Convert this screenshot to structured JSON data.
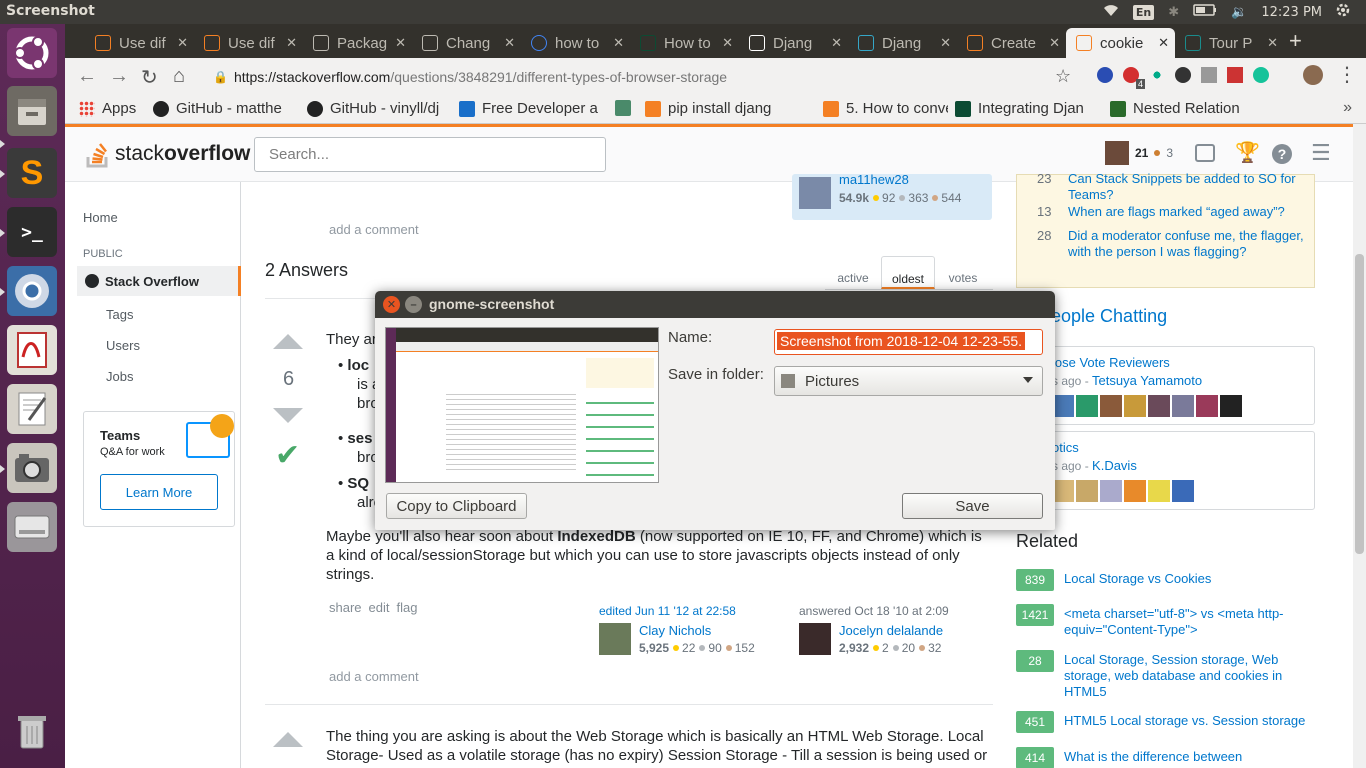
{
  "panel": {
    "app_title": "Screenshot",
    "lang": "En",
    "time": "12:23 PM"
  },
  "browser": {
    "tabs": [
      {
        "label": "Use dif",
        "icon": "so",
        "color": "#f48024"
      },
      {
        "label": "Use dif",
        "icon": "so",
        "color": "#f48024"
      },
      {
        "label": "Packag",
        "icon": "doc",
        "color": "#bdbab2"
      },
      {
        "label": "Chang",
        "icon": "doc",
        "color": "#bdbab2"
      },
      {
        "label": "how to",
        "icon": "G",
        "color": "#4285f4"
      },
      {
        "label": "How to",
        "icon": "dj",
        "color": "#0c4b33"
      },
      {
        "label": "Djang",
        "icon": "gh",
        "color": "#ffffff"
      },
      {
        "label": "Djang",
        "icon": "pk",
        "color": "#35a7c8"
      },
      {
        "label": "Create",
        "icon": "so",
        "color": "#f48024"
      },
      {
        "label": "cookie",
        "icon": "so",
        "color": "#f48024"
      },
      {
        "label": "Tour P",
        "icon": "tp",
        "color": "#1a8c8c"
      }
    ],
    "url_domain": "https://stackoverflow.com",
    "url_path": "/questions/3848291/different-types-of-browser-storage",
    "ext_badge": "4",
    "bookmarks": [
      "Apps",
      "GitHub - matthe",
      "GitHub - vinyll/dj",
      "Free Developer a",
      "",
      "pip install djang",
      "5. How to conver",
      "Integrating Djan",
      "Nested Relation"
    ]
  },
  "so": {
    "logo_a": "stack",
    "logo_b": "overflow",
    "search_placeholder": "Search...",
    "rep": "21",
    "bronze": "3",
    "nav": {
      "home": "Home",
      "public": "PUBLIC",
      "stack_overflow": "Stack Overflow",
      "tags": "Tags",
      "users": "Users",
      "jobs": "Jobs"
    },
    "teams": {
      "title": "Teams",
      "sub": "Q&A for work",
      "btn": "Learn More"
    },
    "question_user": {
      "name": "ma11hew28",
      "rep": "54.9k",
      "gold": "92",
      "silver": "363",
      "bronze": "544"
    },
    "add_comment": "add a comment",
    "answers_count": "2 Answers",
    "sort": [
      "active",
      "oldest",
      "votes"
    ],
    "answer1": {
      "votes": "6",
      "p_intro": "They ar",
      "b1": "loc",
      "b1_cont": "is a",
      "b1_cont2": "bro",
      "b2": "ses",
      "b2_cont": "bro",
      "b3": "SQ",
      "b3_cont": "alre",
      "para_a": "Maybe you'll also hear soon about ",
      "para_b": "IndexedDB",
      "para_c": " (now supported on IE 10, FF, and Chrome) which is a kind of local/sessionStorage but which you can use to store javascripts objects instead of only strings.",
      "actions": [
        "share",
        "edit",
        "flag"
      ],
      "edited": "edited Jun 11 '12 at 22:58",
      "editor": {
        "name": "Clay Nichols",
        "rep": "5,925",
        "gold": "22",
        "silver": "90",
        "bronze": "152"
      },
      "answered": "answered Oct 18 '10 at 2:09",
      "author": {
        "name": "Jocelyn delalande",
        "rep": "2,932",
        "gold": "2",
        "silver": "20",
        "bronze": "32"
      }
    },
    "answer2_text": "The thing you are asking is about the Web Storage which is basically an HTML Web Storage. Local Storage- Used as a volatile storage (has no expiry) Session Storage - Till a session is being used or",
    "meta": [
      {
        "count": "23",
        "title": "Can Stack Snippets be added to SO for Teams?"
      },
      {
        "count": "13",
        "title": "When are flags marked “aged away”?"
      },
      {
        "count": "28",
        "title": "Did a moderator confuse me, the flagger, with the person I was flagging?"
      }
    ],
    "chat_title": "eople Chatting",
    "rooms": [
      {
        "name": "lose Vote Reviewers",
        "ago": "s ago",
        "user": "Tetsuya Yamamoto"
      },
      {
        "name": "otics",
        "ago": "s ago",
        "user": "K.Davis"
      }
    ],
    "related_title": "Related",
    "related": [
      {
        "count": "839",
        "title": "Local Storage vs Cookies"
      },
      {
        "count": "1421",
        "title": "<meta charset=\"utf-8\"> vs <meta http-equiv=\"Content-Type\">"
      },
      {
        "count": "28",
        "title": "Local Storage, Session storage, Web storage, web database and cookies in HTML5"
      },
      {
        "count": "451",
        "title": "HTML5 Local storage vs. Session storage"
      },
      {
        "count": "414",
        "title": "What is the difference between"
      }
    ]
  },
  "dialog": {
    "title": "gnome-screenshot",
    "name_label": "Name:",
    "name_value": "Screenshot from 2018-12-04 12-23-55.",
    "folder_label": "Save in folder:",
    "folder_value": "Pictures",
    "copy": "Copy to Clipboard",
    "save": "Save"
  },
  "colors": {
    "accent": "#f48024",
    "launcher": "#5d2a57",
    "link": "#0077cc",
    "related_badge": "#5eba7d"
  }
}
